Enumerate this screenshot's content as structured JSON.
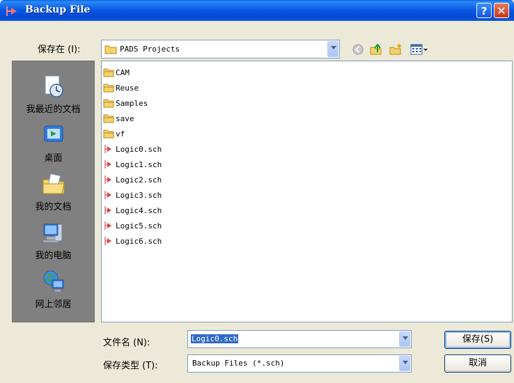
{
  "window": {
    "title": "Backup File",
    "help_label": "?",
    "close_label": "✕"
  },
  "save_in": {
    "label": "保存在 (I):",
    "value": "PADS Projects"
  },
  "toolbar": {
    "icons": [
      "back-icon",
      "up-folder-icon",
      "new-folder-icon",
      "view-menu-icon"
    ]
  },
  "places": [
    {
      "label": "我最近的文档",
      "icon": "recent-documents-icon"
    },
    {
      "label": "桌面",
      "icon": "desktop-icon"
    },
    {
      "label": "我的文档",
      "icon": "my-documents-icon"
    },
    {
      "label": "我的电脑",
      "icon": "my-computer-icon"
    },
    {
      "label": "网上邻居",
      "icon": "network-places-icon"
    }
  ],
  "files": [
    {
      "name": "CAM",
      "type": "folder"
    },
    {
      "name": "Reuse",
      "type": "folder"
    },
    {
      "name": "Samples",
      "type": "folder"
    },
    {
      "name": "save",
      "type": "folder"
    },
    {
      "name": "vf",
      "type": "folder"
    },
    {
      "name": "Logic0.sch",
      "type": "sch"
    },
    {
      "name": "Logic1.sch",
      "type": "sch"
    },
    {
      "name": "Logic2.sch",
      "type": "sch"
    },
    {
      "name": "Logic3.sch",
      "type": "sch"
    },
    {
      "name": "Logic4.sch",
      "type": "sch"
    },
    {
      "name": "Logic5.sch",
      "type": "sch"
    },
    {
      "name": "Logic6.sch",
      "type": "sch"
    }
  ],
  "filename": {
    "label": "文件名 (N):",
    "value": "Logic0.sch"
  },
  "filetype": {
    "label": "保存类型 (T):",
    "value": "Backup Files (*.sch)"
  },
  "buttons": {
    "save": "保存(S)",
    "cancel": "取消"
  },
  "colors": {
    "titlebar": "#0a5be6",
    "selection": "#316ac5",
    "places_bg": "#808080",
    "dialog_bg": "#ece9d8"
  }
}
